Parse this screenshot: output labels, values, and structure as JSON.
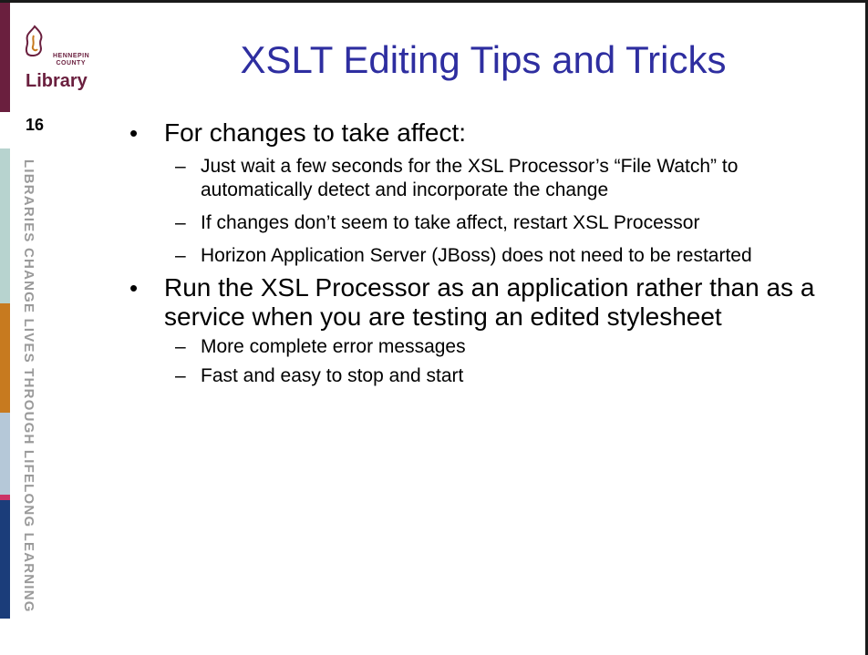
{
  "logo": {
    "small_text_line1": "HENNEPIN",
    "small_text_line2": "COUNTY",
    "word": "Library"
  },
  "slide_number": "16",
  "tagline": "LIBRARIES CHANGE LIVES THROUGH LIFELONG LEARNING",
  "colors": {
    "title": "#2e2ea0",
    "brand": "#6a1f3e",
    "strip": [
      "#6a1f3e",
      "#b7d3cf",
      "#c77a1f",
      "#b5c8d8",
      "#cc3366",
      "#1b3d7a"
    ]
  },
  "title": "XSLT Editing Tips and Tricks",
  "bullets": [
    {
      "text": "For changes to take affect:",
      "sub": [
        "Just wait a few seconds for the XSL Processor’s “File Watch” to automatically detect and incorporate the change",
        "If changes don’t seem to take affect, restart XSL Processor",
        "Horizon Application Server (JBoss) does not need to be restarted"
      ]
    },
    {
      "text": "Run the XSL Processor as an application rather than as a service when you are testing an edited stylesheet",
      "sub": [
        "More complete error messages",
        "Fast and easy to stop and start"
      ]
    }
  ]
}
